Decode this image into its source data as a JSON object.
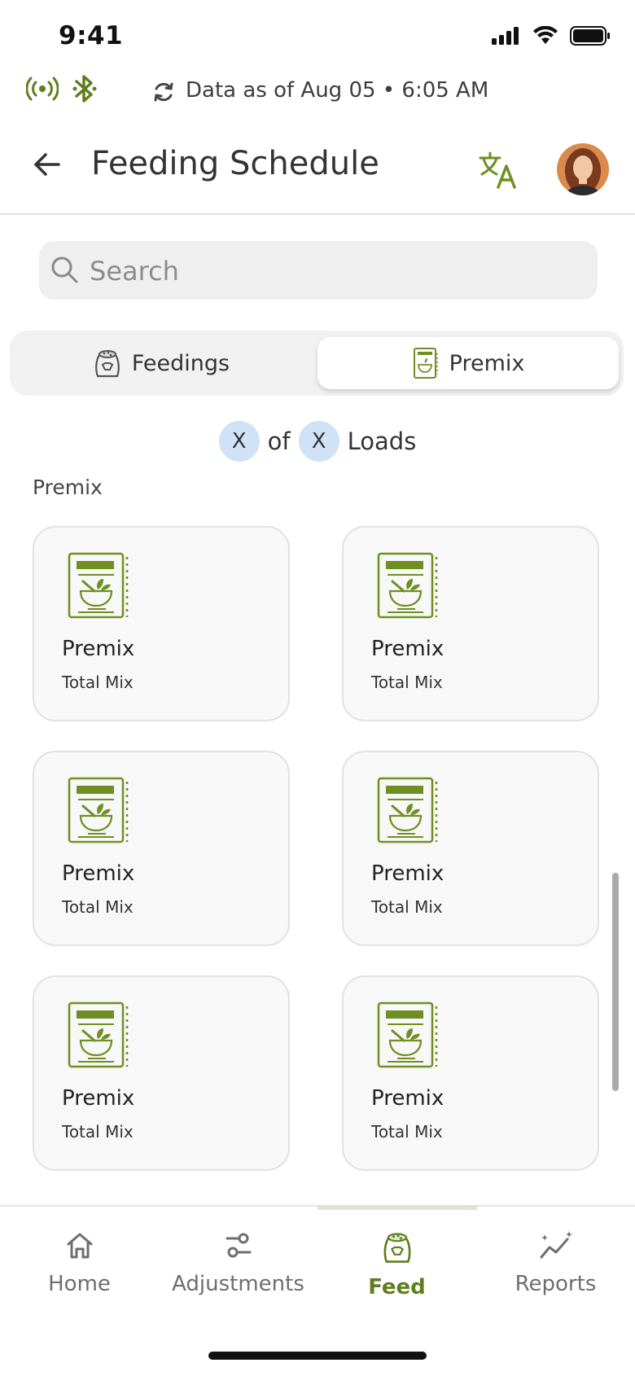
{
  "status_bar": {
    "time": "9:41"
  },
  "sync": {
    "text": "Data as of Aug 05 • 6:05 AM"
  },
  "header": {
    "title": "Feeding Schedule"
  },
  "search": {
    "placeholder": "Search"
  },
  "tabs": [
    {
      "label": "Feedings",
      "icon": "feed-bag-icon",
      "selected": false
    },
    {
      "label": "Premix",
      "icon": "premix-book-icon",
      "selected": true
    }
  ],
  "loads": {
    "current": "X",
    "of_label": "of",
    "total": "X",
    "suffix": "Loads"
  },
  "section": {
    "label": "Premix"
  },
  "cards": [
    {
      "title": "Premix",
      "subtitle": "Total Mix"
    },
    {
      "title": "Premix",
      "subtitle": "Total Mix"
    },
    {
      "title": "Premix",
      "subtitle": "Total Mix"
    },
    {
      "title": "Premix",
      "subtitle": "Total Mix"
    },
    {
      "title": "Premix",
      "subtitle": "Total Mix"
    },
    {
      "title": "Premix",
      "subtitle": "Total Mix"
    }
  ],
  "bottom_nav": [
    {
      "label": "Home",
      "icon": "home-icon",
      "active": false
    },
    {
      "label": "Adjustments",
      "icon": "adjustments-icon",
      "active": false
    },
    {
      "label": "Feed",
      "icon": "feed-bag-icon",
      "active": true
    },
    {
      "label": "Reports",
      "icon": "reports-icon",
      "active": false
    }
  ],
  "colors": {
    "accent": "#5f7e1f",
    "icon_green": "#6f8f22",
    "loads_pill": "#cfe2f7"
  }
}
